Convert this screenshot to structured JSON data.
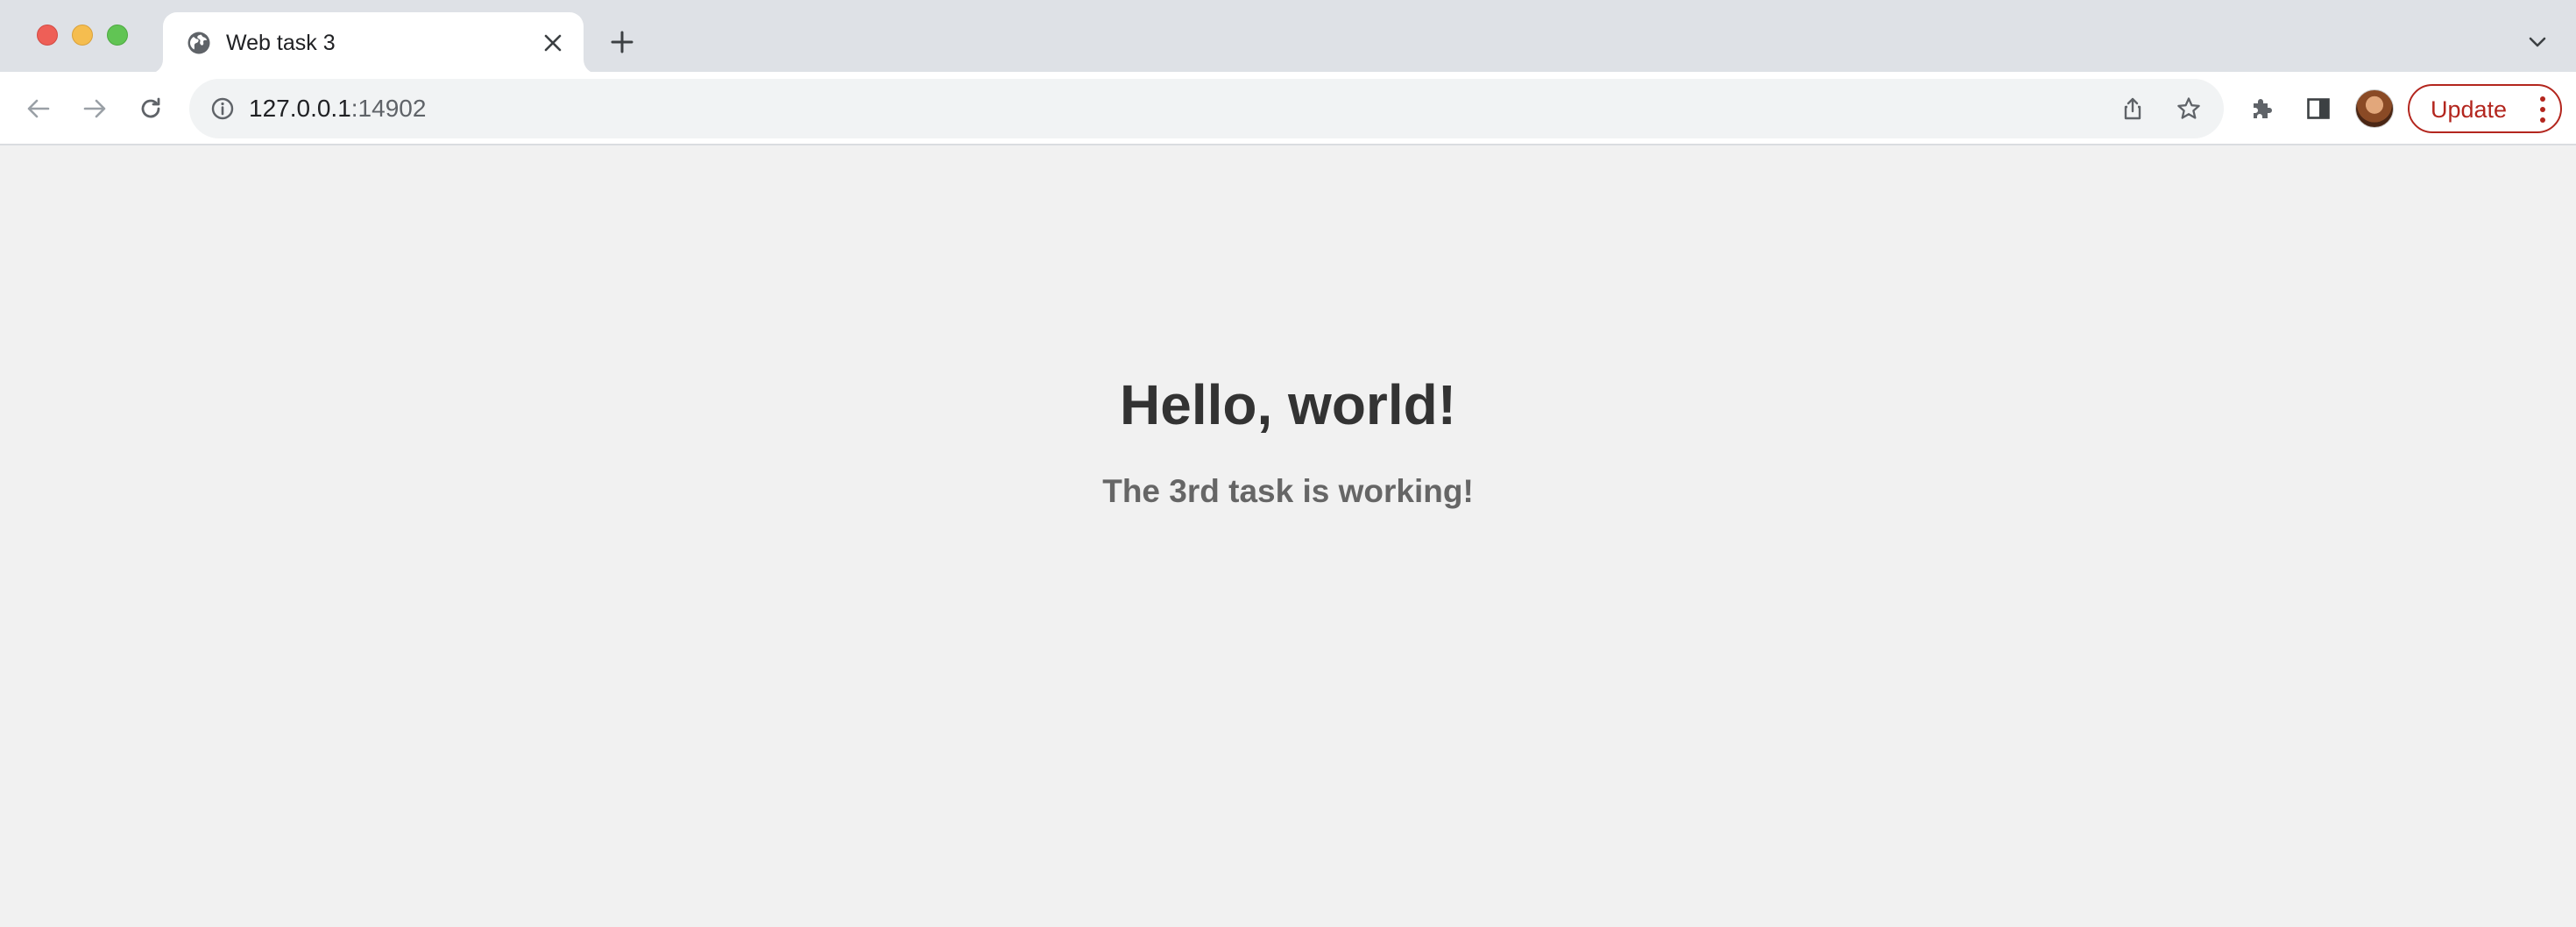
{
  "browser": {
    "tab": {
      "title": "Web task 3",
      "favicon": "globe-icon"
    },
    "address_bar": {
      "host": "127.0.0.1",
      "port": ":14902"
    },
    "update_button": {
      "label": "Update"
    },
    "colors": {
      "update_accent": "#b3261e",
      "tabstrip_bg": "#dee1e6",
      "page_bg": "#f1f1f1"
    }
  },
  "page": {
    "heading": "Hello, world!",
    "subheading": "The 3rd task is working!"
  }
}
